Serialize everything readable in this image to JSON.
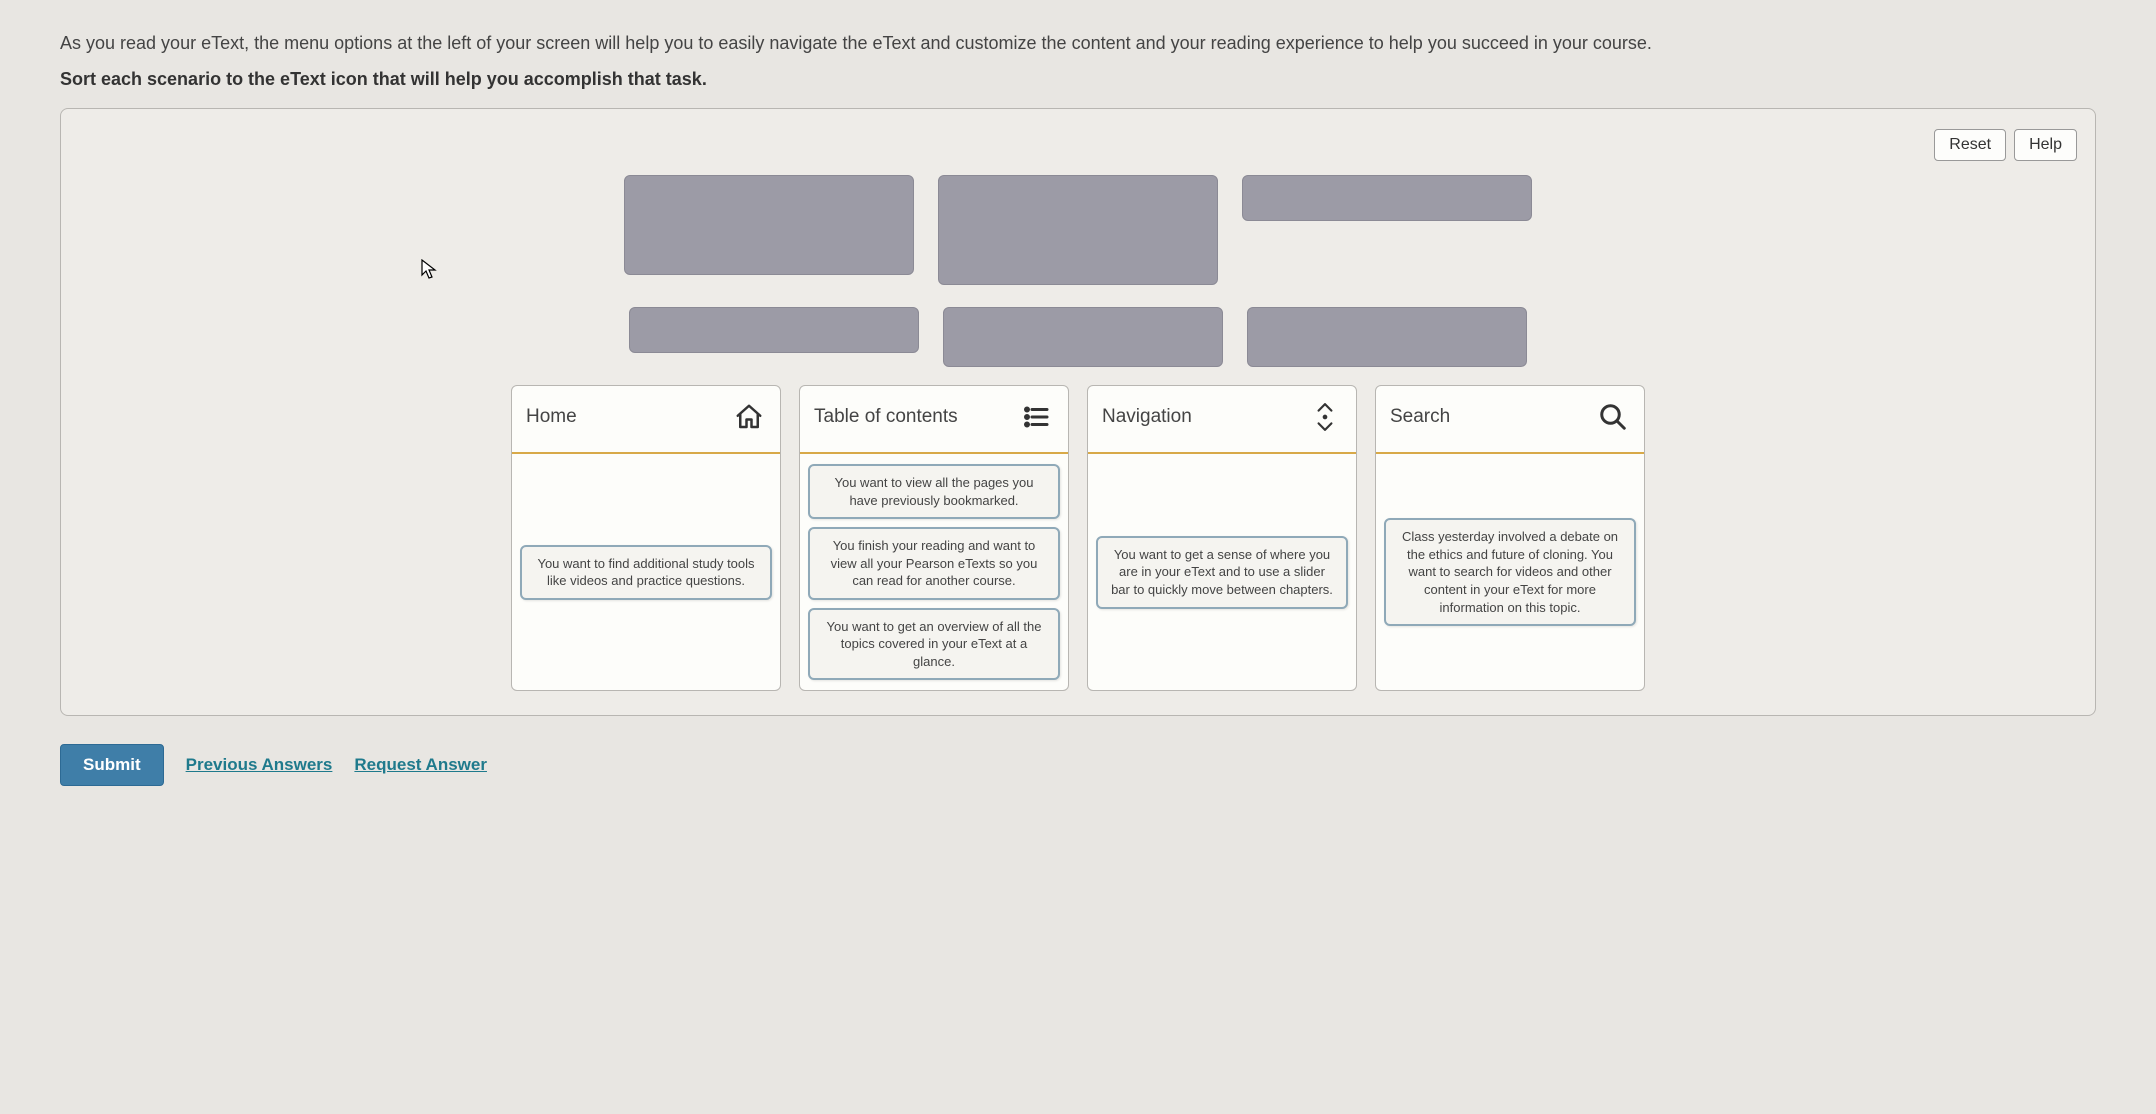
{
  "intro": "As you read your eText, the menu options at the left of your screen will help you to easily navigate the eText and customize the content and your reading experience to help you succeed in your course.",
  "instruction": "Sort each scenario to the eText icon that will help you accomplish that task.",
  "buttons": {
    "reset": "Reset",
    "help": "Help",
    "submit": "Submit",
    "previous_answers": "Previous Answers",
    "request_answer": "Request Answer"
  },
  "targets": [
    {
      "title": "Home",
      "icon": "home-icon",
      "cards": [
        "You want to find additional study tools like videos and practice questions."
      ]
    },
    {
      "title": "Table of contents",
      "icon": "toc-icon",
      "cards": [
        "You want to view all the pages you have previously bookmarked.",
        "You finish your reading and want to view all your Pearson eTexts so you can read for another course.",
        "You want to get an overview of all the topics covered in your eText at a glance."
      ]
    },
    {
      "title": "Navigation",
      "icon": "navigation-icon",
      "cards": [
        "You want to get a sense of where you are in your eText and to use a slider bar to quickly move between chapters."
      ]
    },
    {
      "title": "Search",
      "icon": "search-icon",
      "cards": [
        "Class yesterday involved a debate on the ethics and future of cloning. You want to search for videos and other content in your eText for more information on this topic."
      ]
    }
  ]
}
